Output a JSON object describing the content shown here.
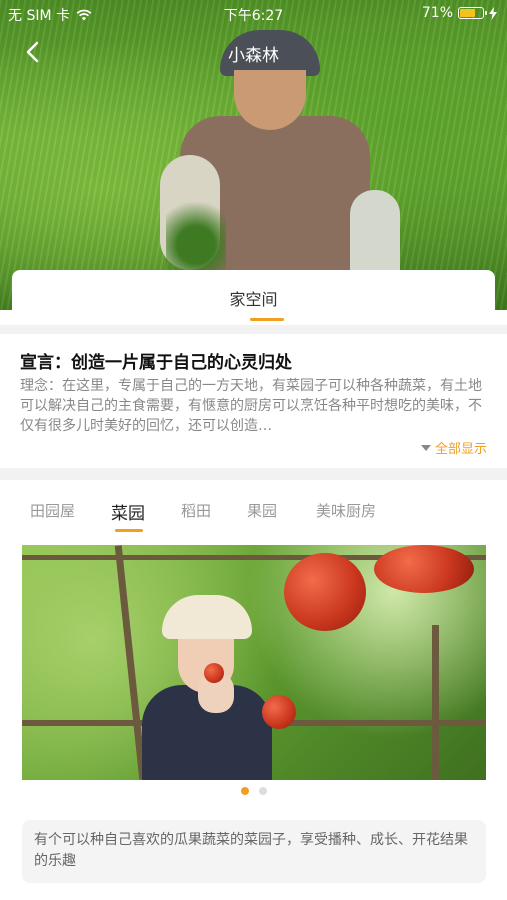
{
  "status_bar": {
    "carrier": "无 SIM 卡",
    "time": "下午6:27",
    "battery": "71%",
    "battery_level": 0.71
  },
  "nav": {
    "title": "小森林"
  },
  "space_tab": {
    "label": "家空间"
  },
  "declaration": {
    "title": "宣言：创造一片属于自己的心灵归处",
    "body": "理念：在这里，专属于自己的一方天地，有菜园子可以种各种蔬菜，有土地可以解决自己的主食需要，有惬意的厨房可以烹饪各种平时想吃的美味，不仅有很多儿时美好的回忆，还可以创造…",
    "show_all": "全部显示"
  },
  "categories": {
    "tabs": [
      "田园屋",
      "菜园",
      "稻田",
      "果园",
      "美味厨房"
    ],
    "active_index": 1
  },
  "carousel": {
    "page_count": 2,
    "active_index": 0
  },
  "description": "有个可以种自己喜欢的瓜果蔬菜的菜园子，享受播种、成长、开花结果的乐趣",
  "colors": {
    "accent": "#f0a020",
    "battery": "#f2c31a"
  }
}
